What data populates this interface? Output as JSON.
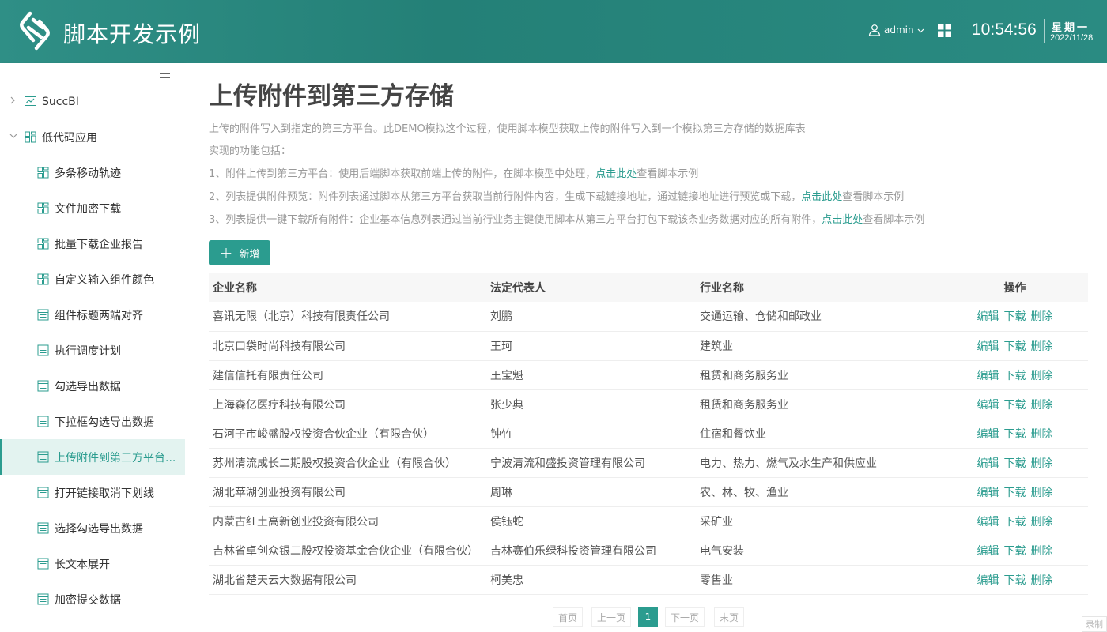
{
  "header": {
    "app_title": "脚本开发示例",
    "user_name": "admin",
    "clock": "10:54:56",
    "weekday": "星期一",
    "date": "2022/11/28",
    "colors": {
      "header_bg": "#248077",
      "accent": "#2b9c8f"
    }
  },
  "sidebar": {
    "items": [
      {
        "label": "SuccBI",
        "level": 1,
        "caret": "›",
        "icon": "chart-icon"
      },
      {
        "label": "低代码应用",
        "level": 1,
        "caret": "⌄",
        "icon": "app-grid-icon"
      },
      {
        "label": "多条移动轨迹",
        "level": 2,
        "icon": "app-grid-icon"
      },
      {
        "label": "文件加密下载",
        "level": 2,
        "icon": "app-grid-icon"
      },
      {
        "label": "批量下载企业报告",
        "level": 2,
        "icon": "app-grid-icon"
      },
      {
        "label": "自定义输入组件颜色",
        "level": 2,
        "icon": "app-grid-icon"
      },
      {
        "label": "组件标题两端对齐",
        "level": 2,
        "icon": "form-icon"
      },
      {
        "label": "执行调度计划",
        "level": 2,
        "icon": "form-icon"
      },
      {
        "label": "勾选导出数据",
        "level": 2,
        "icon": "form-icon"
      },
      {
        "label": "下拉框勾选导出数据",
        "level": 2,
        "icon": "form-icon"
      },
      {
        "label": "上传附件到第三方平台...",
        "level": 2,
        "icon": "form-icon",
        "active": true
      },
      {
        "label": "打开链接取消下划线",
        "level": 2,
        "icon": "form-icon"
      },
      {
        "label": "选择勾选导出数据",
        "level": 2,
        "icon": "form-icon"
      },
      {
        "label": "长文本展开",
        "level": 2,
        "icon": "form-icon"
      },
      {
        "label": "加密提交数据",
        "level": 2,
        "icon": "form-icon"
      }
    ]
  },
  "main": {
    "title": "上传附件到第三方存储",
    "desc": {
      "line1": "上传的附件写入到指定的第三方平台。此DEMO模拟这个过程，使用脚本模型获取上传的附件写入到一个模拟第三方存储的数据库表",
      "line2": "实现的功能包括：",
      "line3_pre": "1、附件上传到第三方平台：使用后端脚本获取前端上传的附件，在脚本模型中处理，",
      "line4_pre": "2、列表提供附件预览：附件列表通过脚本从第三方平台获取当前行附件内容，生成下载链接地址，通过链接地址进行预览或下载，",
      "line5_pre": "3、列表提供一键下载所有附件：企业基本信息列表通过当前行业务主键使用脚本从第三方平台打包下载该条业务数据对应的所有附件，",
      "link": "点击此处",
      "suffix": "查看脚本示例"
    },
    "add_label": "新增",
    "table": {
      "columns": [
        "企业名称",
        "法定代表人",
        "行业名称",
        "操作"
      ],
      "op_labels": [
        "编辑",
        "下载",
        "删除"
      ],
      "rows": [
        [
          "喜讯无限（北京）科技有限责任公司",
          "刘鹏",
          "交通运输、仓储和邮政业"
        ],
        [
          "北京口袋时尚科技有限公司",
          "王珂",
          "建筑业"
        ],
        [
          "建信信托有限责任公司",
          "王宝魁",
          "租赁和商务服务业"
        ],
        [
          "上海森亿医疗科技有限公司",
          "张少典",
          "租赁和商务服务业"
        ],
        [
          "石河子市峻盛股权投资合伙企业（有限合伙）",
          "钟竹",
          "住宿和餐饮业"
        ],
        [
          "苏州清流成长二期股权投资合伙企业（有限合伙）",
          "宁波清流和盛投资管理有限公司",
          "电力、热力、燃气及水生产和供应业"
        ],
        [
          "湖北苹湖创业投资有限公司",
          "周琳",
          "农、林、牧、渔业"
        ],
        [
          "内蒙古红土高新创业投资有限公司",
          "侯钰蛇",
          "采矿业"
        ],
        [
          "吉林省卓创众银二股权投资基金合伙企业（有限合伙）",
          "吉林赛伯乐绿科投资管理有限公司",
          "电气安装"
        ],
        [
          "湖北省楚天云大数据有限公司",
          "柯美忠",
          "零售业"
        ]
      ]
    },
    "pager": {
      "first": "首页",
      "prev": "上一页",
      "current": "1",
      "next": "下一页",
      "last": "末页"
    }
  },
  "corner_tag": "录制"
}
